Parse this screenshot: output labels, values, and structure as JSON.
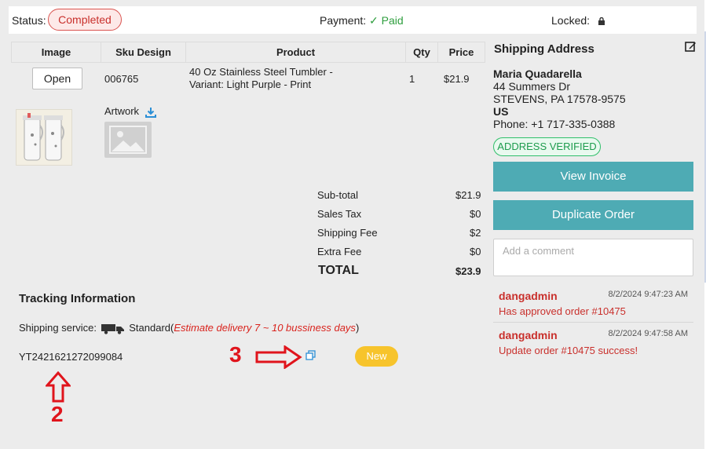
{
  "status": {
    "label": "Status:",
    "value": "Completed",
    "payment_label": "Payment:",
    "payment_value": "✓ Paid",
    "locked_label": "Locked:"
  },
  "items_table": {
    "headers": [
      "Image",
      "Sku Design",
      "Product",
      "Qty",
      "Price"
    ],
    "rows": [
      {
        "open_label": "Open",
        "sku": "006765",
        "product_line1": "40 Oz Stainless Steel Tumbler -",
        "product_line2": "Variant: Light Purple - Print",
        "qty": "1",
        "price": "$21.9",
        "artwork_label": "Artwork"
      }
    ]
  },
  "summary": {
    "subtotal_label": "Sub-total",
    "subtotal": "$21.9",
    "tax_label": "Sales Tax",
    "tax": "$0",
    "shipping_label": "Shipping Fee",
    "shipping": "$2",
    "extra_label": "Extra Fee",
    "extra": "$0",
    "total_label": "TOTAL",
    "total": "$23.9"
  },
  "tracking": {
    "title": "Tracking Information",
    "service_label": "Shipping service:",
    "service_name": "Standard(",
    "estimate": "Estimate delivery 7 ~ 10 bussiness days",
    "close_paren": ")",
    "number": "YT2421621272099084",
    "badge": "New"
  },
  "annotations": {
    "arrow2": "2",
    "arrow3": "3"
  },
  "shipping_address": {
    "title": "Shipping Address",
    "name": "Maria Quadarella",
    "street": "44 Summers Dr",
    "city": "STEVENS, PA 17578-9575",
    "country": "US",
    "phone": "Phone: +1 717-335-0388",
    "verified": "ADDRESS VERIFIED"
  },
  "actions": {
    "view_invoice": "View Invoice",
    "duplicate_order": "Duplicate Order",
    "comment_placeholder": "Add a comment"
  },
  "logs": [
    {
      "user": "dangadmin",
      "time": "8/2/2024 9:47:23 AM",
      "message": "Has approved order #10475"
    },
    {
      "user": "dangadmin",
      "time": "8/2/2024 9:47:58 AM",
      "message": "Update order #10475 success!"
    }
  ],
  "colors": {
    "teal": "#4eabb4",
    "status_red": "#c9302c",
    "paid_green": "#2e9e3e",
    "badge_yellow": "#f7c42c",
    "annotation_red": "#e0141c"
  }
}
